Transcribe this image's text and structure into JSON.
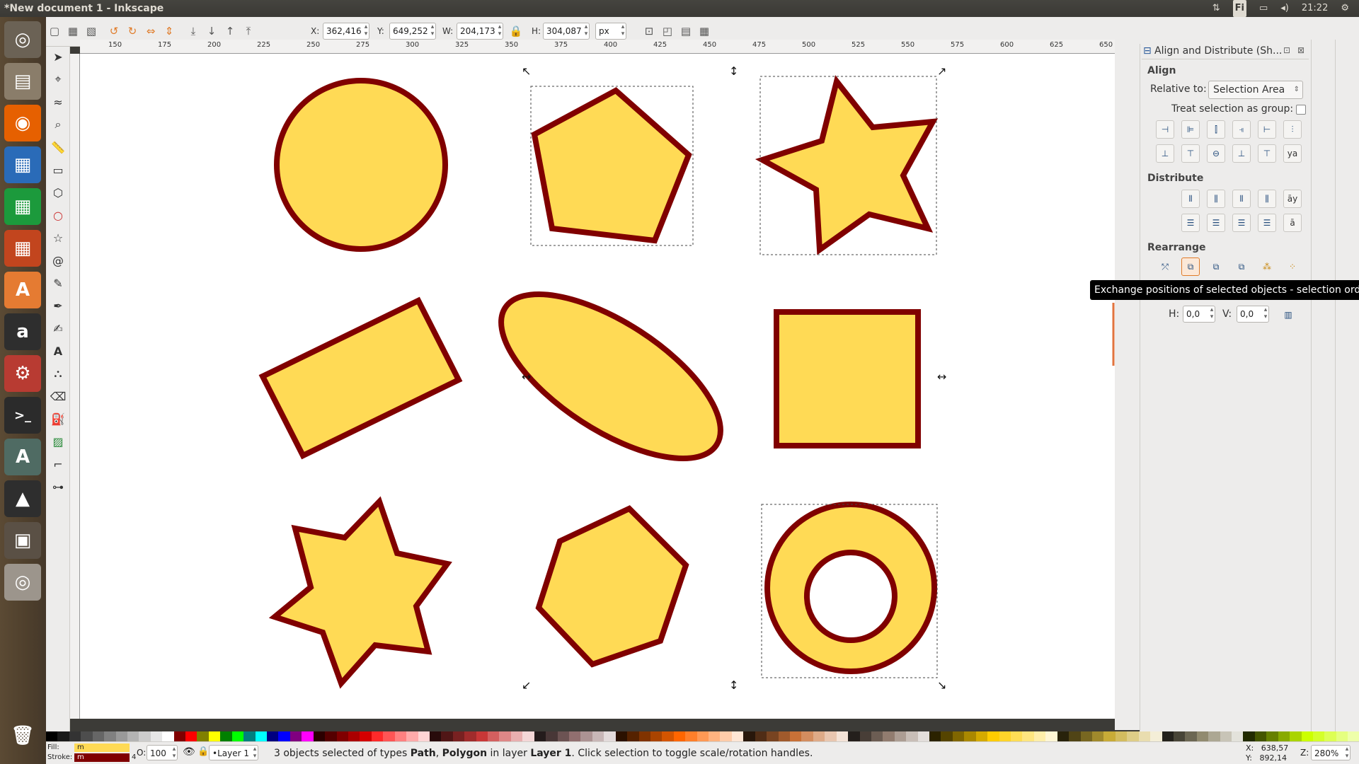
{
  "window": {
    "title": "*New document 1 - Inkscape"
  },
  "tray": {
    "keyboard": "Fi",
    "time": "21:22"
  },
  "launcher": {
    "items": [
      {
        "name": "dash-home-icon",
        "glyph": "◎",
        "color": "#6b6255"
      },
      {
        "name": "files-icon",
        "glyph": "▤",
        "color": "#8a7d6a"
      },
      {
        "name": "firefox-icon",
        "glyph": "◉",
        "color": "#e66000"
      },
      {
        "name": "writer-icon",
        "glyph": "▦",
        "color": "#2a6bb8"
      },
      {
        "name": "calc-icon",
        "glyph": "▦",
        "color": "#1c9a3c"
      },
      {
        "name": "impress-icon",
        "glyph": "▦",
        "color": "#c2451e"
      },
      {
        "name": "software-center-icon",
        "glyph": "A",
        "color": "#e57b32"
      },
      {
        "name": "amazon-icon",
        "glyph": "a",
        "color": "#2e2e2e"
      },
      {
        "name": "settings-icon",
        "glyph": "⚙",
        "color": "#b83b32"
      },
      {
        "name": "terminal-icon",
        "glyph": ">_",
        "color": "#2b2b2b"
      },
      {
        "name": "updater-icon",
        "glyph": "A",
        "color": "#4f6b63"
      },
      {
        "name": "inkscape-icon",
        "glyph": "▲",
        "color": "#2e2e2e"
      },
      {
        "name": "workspaces-icon",
        "glyph": "▣",
        "color": "#5a5045"
      },
      {
        "name": "dvd-icon",
        "glyph": "◎",
        "color": "#9c958c"
      }
    ],
    "trash": "🗑"
  },
  "toolbar": {
    "x_label": "X:",
    "x": "362,416",
    "y_label": "Y:",
    "y": "649,252",
    "w_label": "W:",
    "w": "204,173",
    "h_label": "H:",
    "h": "304,087",
    "unit": "px"
  },
  "ruler": {
    "ticks": [
      "150",
      "175",
      "200",
      "225",
      "250",
      "275",
      "300",
      "325",
      "350",
      "375",
      "400",
      "425",
      "450",
      "475",
      "500",
      "525",
      "550",
      "575",
      "600",
      "625",
      "650"
    ]
  },
  "dialog": {
    "title": "Align and Distribute (Sh...",
    "align_header": "Align",
    "relative_label": "Relative to:",
    "relative_value": "Selection Area",
    "group_label": "Treat selection as group:",
    "distribute_header": "Distribute",
    "rearrange_header": "Rearrange",
    "h_label": "H:",
    "h_value": "0,0",
    "v_label": "V:",
    "v_value": "0,0"
  },
  "tooltip": "Exchange positions of selected objects - selection order",
  "shapes": {
    "fill": "#ffda55",
    "stroke": "#800000"
  },
  "status": {
    "fill_label": "Fill:",
    "stroke_label": "Stroke:",
    "fill_swatch": "m",
    "stroke_swatch": "m",
    "stroke_width": "4",
    "opacity_label": "O:",
    "opacity": "100",
    "layer": "•Layer 1",
    "message_pre": "3 objects selected of types ",
    "message_types1": "Path",
    "message_sep": ", ",
    "message_types2": "Polygon",
    "message_mid": " in layer ",
    "message_layer": "Layer 1",
    "message_post": ". Click selection to toggle scale/rotation handles.",
    "cursor_x": "X:   638,57",
    "cursor_y": "Y:   892,14",
    "zoom_label": "Z:",
    "zoom": "280%"
  },
  "palette": [
    "#000000",
    "#1a1a1a",
    "#333333",
    "#4d4d4d",
    "#666666",
    "#808080",
    "#999999",
    "#b3b3b3",
    "#cccccc",
    "#e6e6e6",
    "#ffffff",
    "#800000",
    "#ff0000",
    "#808000",
    "#ffff00",
    "#008000",
    "#00ff00",
    "#008080",
    "#00ffff",
    "#000080",
    "#0000ff",
    "#800080",
    "#ff00ff",
    "#2b0000",
    "#550000",
    "#800000",
    "#aa0000",
    "#d40000",
    "#ff2a2a",
    "#ff5555",
    "#ff8080",
    "#ffaaaa",
    "#ffd5d5",
    "#280b0b",
    "#501616",
    "#782121",
    "#a02c2c",
    "#c83737",
    "#d35f5f",
    "#de8787",
    "#e9afaf",
    "#f4d7d7",
    "#241c1c",
    "#483737",
    "#6c5353",
    "#916f6f",
    "#ac9393",
    "#c8b7b7",
    "#e3dbdb",
    "#2b1100",
    "#552200",
    "#803300",
    "#aa4400",
    "#d45500",
    "#ff6600",
    "#ff7f2a",
    "#ff9955",
    "#ffb380",
    "#ffccaa",
    "#ffe6d5",
    "#28170b",
    "#502d16",
    "#784421",
    "#a05a2c",
    "#c87137",
    "#d38d5f",
    "#deaa87",
    "#e9c6af",
    "#f4e3d7",
    "#241f1c",
    "#483e37",
    "#6c5d53",
    "#917c6f",
    "#ac9d93",
    "#c8beb7",
    "#e3dedb",
    "#2b2200",
    "#554400",
    "#806600",
    "#aa8800",
    "#d4aa00",
    "#ffcc00",
    "#ffd42a",
    "#ffdd55",
    "#ffe680",
    "#ffeeaa",
    "#fff6d5",
    "#28220b",
    "#504416",
    "#786721",
    "#a0892c",
    "#c8ab37",
    "#d3bc5f",
    "#decd87",
    "#e9ddaf",
    "#f4eed7",
    "#24221c",
    "#484537",
    "#6c6753",
    "#918a6f",
    "#aca793",
    "#c8c4b7",
    "#e3e2db",
    "#222b00",
    "#445500",
    "#668000",
    "#88aa00",
    "#aad400",
    "#ccff00",
    "#d4ff2a",
    "#ddff55",
    "#e5ff80",
    "#eeffaa"
  ]
}
